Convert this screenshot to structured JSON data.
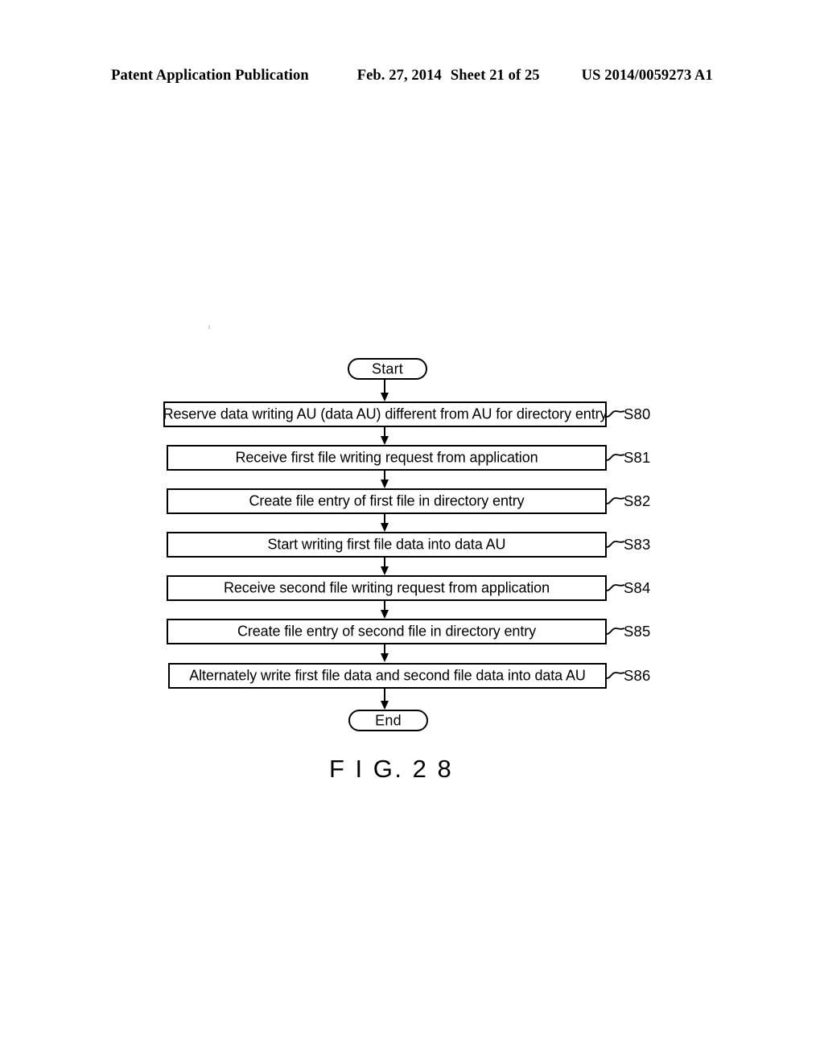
{
  "header": {
    "publication": "Patent Application Publication",
    "date": "Feb. 27, 2014",
    "sheet": "Sheet 21 of 25",
    "document_number": "US 2014/0059273 A1"
  },
  "figure": {
    "caption": "F I G. 2 8"
  },
  "flowchart": {
    "start_label": "Start",
    "end_label": "End",
    "steps": [
      {
        "id": "S80",
        "text": "Reserve data writing AU (data AU) different from AU for directory entry"
      },
      {
        "id": "S81",
        "text": "Receive first file writing request from application"
      },
      {
        "id": "S82",
        "text": "Create file entry of first file in directory entry"
      },
      {
        "id": "S83",
        "text": "Start writing first file data into data AU"
      },
      {
        "id": "S84",
        "text": "Receive second file writing request from application"
      },
      {
        "id": "S85",
        "text": "Create file entry of second file in directory entry"
      },
      {
        "id": "S86",
        "text": "Alternately write first file data and second file data into data AU"
      }
    ]
  },
  "colors": {
    "ink": "#000000",
    "paper": "#ffffff"
  }
}
